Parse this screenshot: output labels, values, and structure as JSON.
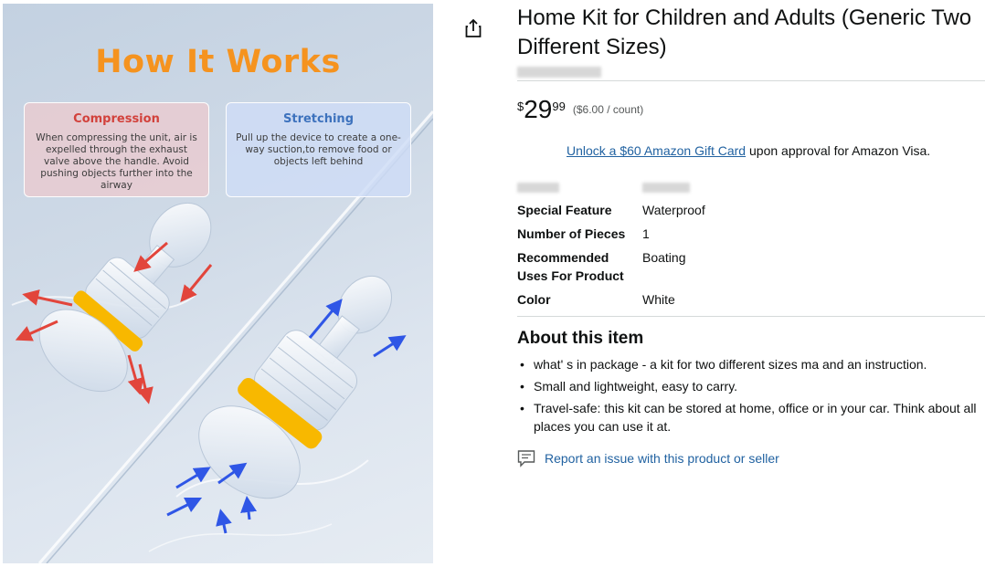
{
  "product_image": {
    "heading": "How It Works",
    "left_card": {
      "title": "Compression",
      "text": "When compressing the unit, air is expelled through the exhaust valve above the handle. Avoid pushing objects further into the airway"
    },
    "right_card": {
      "title": "Stretching",
      "text": "Pull up the device to create a one-way suction,to remove food or objects left behind"
    },
    "colors": {
      "heading": "#f5931f",
      "compression": "#d2423c",
      "stretching": "#3d72bd",
      "ring": "#f8b800"
    }
  },
  "share": {
    "icon": "share-icon"
  },
  "product": {
    "title": "Home Kit for Children and Adults (Generic Two Different Sizes)"
  },
  "price": {
    "symbol": "$",
    "whole": "29",
    "fraction": "99",
    "unit_price": "($6.00 / count)"
  },
  "promo": {
    "link_text": "Unlock a $60 Amazon Gift Card",
    "rest_text": " upon approval for Amazon Visa."
  },
  "specs": [
    {
      "key": "Special Feature",
      "value": "Waterproof"
    },
    {
      "key": "Number of Pieces",
      "value": "1"
    },
    {
      "key": "Recommended Uses For Product",
      "value": "Boating"
    },
    {
      "key": "Color",
      "value": "White"
    }
  ],
  "about": {
    "heading": "About this item",
    "bullets": [
      "what' s in package - a kit for two different sizes ma and an instruction.",
      "Small and lightweight, easy to carry.",
      "Travel-safe: this kit can be stored at home, office or in your car. Think about all places you can use it at."
    ]
  },
  "report": {
    "icon": "feedback-icon",
    "text": "Report an issue with this product or seller"
  },
  "theme": {
    "link": "#2162a1",
    "text": "#0f1111",
    "muted": "#565959"
  }
}
